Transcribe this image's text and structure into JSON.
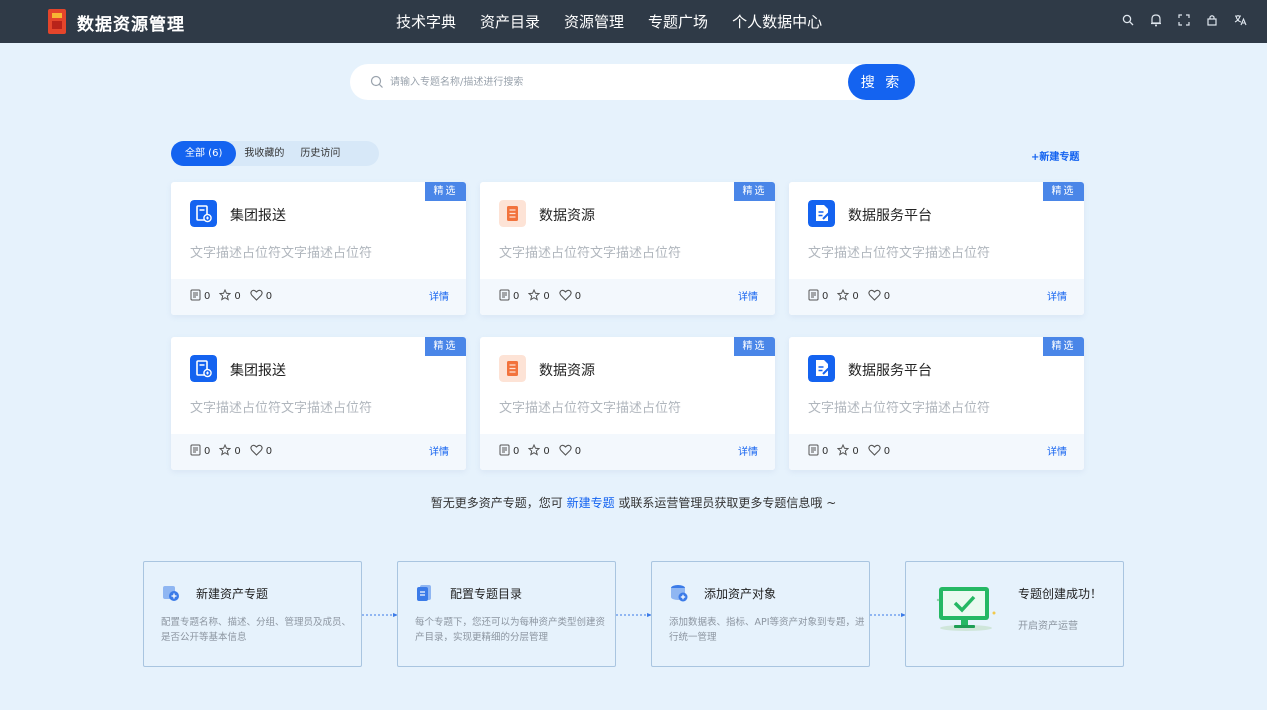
{
  "app": {
    "title": "数据资源管理"
  },
  "nav": {
    "items": [
      "技术字典",
      "资产目录",
      "资源管理",
      "专题广场",
      "个人数据中心"
    ]
  },
  "tools": [
    "search-icon",
    "bell-icon",
    "fullscreen-icon",
    "lock-icon",
    "translate-icon"
  ],
  "search": {
    "placeholder": "请输入专题名称/描述进行搜索",
    "button": "搜 索"
  },
  "filters": {
    "all": "全部 (6)",
    "favorites": "我收藏的",
    "history": "历史访问"
  },
  "new_topic": "+新建专题",
  "cards": [
    {
      "title": "集团报送",
      "desc": "文字描述占位符文字描述占位符",
      "badge": "精选",
      "docs": "0",
      "stars": "0",
      "likes": "0",
      "detail": "详情",
      "icon": "report-icon"
    },
    {
      "title": "数据资源",
      "desc": "文字描述占位符文字描述占位符",
      "badge": "精选",
      "docs": "0",
      "stars": "0",
      "likes": "0",
      "detail": "详情",
      "icon": "resource-icon"
    },
    {
      "title": "数据服务平台",
      "desc": "文字描述占位符文字描述占位符",
      "badge": "精选",
      "docs": "0",
      "stars": "0",
      "likes": "0",
      "detail": "详情",
      "icon": "service-icon"
    },
    {
      "title": "集团报送",
      "desc": "文字描述占位符文字描述占位符",
      "badge": "精选",
      "docs": "0",
      "stars": "0",
      "likes": "0",
      "detail": "详情",
      "icon": "report-icon"
    },
    {
      "title": "数据资源",
      "desc": "文字描述占位符文字描述占位符",
      "badge": "精选",
      "docs": "0",
      "stars": "0",
      "likes": "0",
      "detail": "详情",
      "icon": "resource-icon"
    },
    {
      "title": "数据服务平台",
      "desc": "文字描述占位符文字描述占位符",
      "badge": "精选",
      "docs": "0",
      "stars": "0",
      "likes": "0",
      "detail": "详情",
      "icon": "service-icon"
    }
  ],
  "info": {
    "before": "暂无更多资产专题，您可 ",
    "link": "新建专题",
    "after": " 或联系运营管理员获取更多专题信息哦 ~"
  },
  "steps": [
    {
      "title": "新建资产专题",
      "desc": "配置专题名称、描述、分组、管理员及成员、是否公开等基本信息"
    },
    {
      "title": "配置专题目录",
      "desc": "每个专题下，您还可以为每种资产类型创建资产目录，实现更精细的分层管理"
    },
    {
      "title": "添加资产对象",
      "desc": "添加数据表、指标、API等资产对象到专题，进行统一管理"
    },
    {
      "title": "专题创建成功！",
      "desc": "开启资产运营"
    }
  ],
  "colors": {
    "primary": "#1463f0",
    "topbar": "#2f3a47",
    "page_bg": "#e6f2fc",
    "badge": "#4a86e8"
  }
}
